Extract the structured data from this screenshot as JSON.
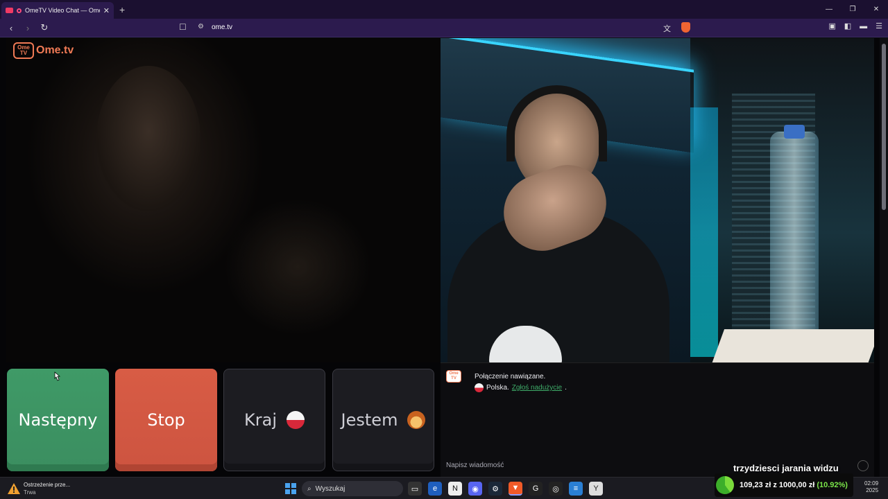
{
  "browser": {
    "tab_title": "OmeTV Video Chat — Omeg",
    "url": "ome.tv",
    "new_tab_label": "+",
    "window_controls": [
      "—",
      "❐",
      "✕"
    ]
  },
  "page": {
    "logo_text": "Ome.tv",
    "logo_badge": "Ome TV"
  },
  "buttons": {
    "next": "Następny",
    "stop": "Stop",
    "country": "Kraj",
    "me": "Jestem"
  },
  "chat": {
    "connected_message": "Połączenie nawiązane.",
    "country": "Polska.",
    "report_link": "Zgłoś nadużycie",
    "report_suffix": ".",
    "input_placeholder": "Napisz wiadomość"
  },
  "stream_overlay": {
    "title": "trzydziesci jarania widzu",
    "donation_current": "109,23 zł",
    "donation_sep": "z",
    "donation_goal": "1000,00 zł",
    "donation_pct": "(10.92%)",
    "donation_fraction": 0.1092
  },
  "taskbar": {
    "warning_title": "Ostrzeżenie prze...",
    "warning_subtitle": "Trwa",
    "search_placeholder": "Wyszukaj",
    "clock_time": "02:09",
    "clock_date": "2025"
  },
  "colors": {
    "next": "#3f9a67",
    "stop": "#d85c45",
    "brand": "#f07a55",
    "link": "#3fae6a"
  }
}
